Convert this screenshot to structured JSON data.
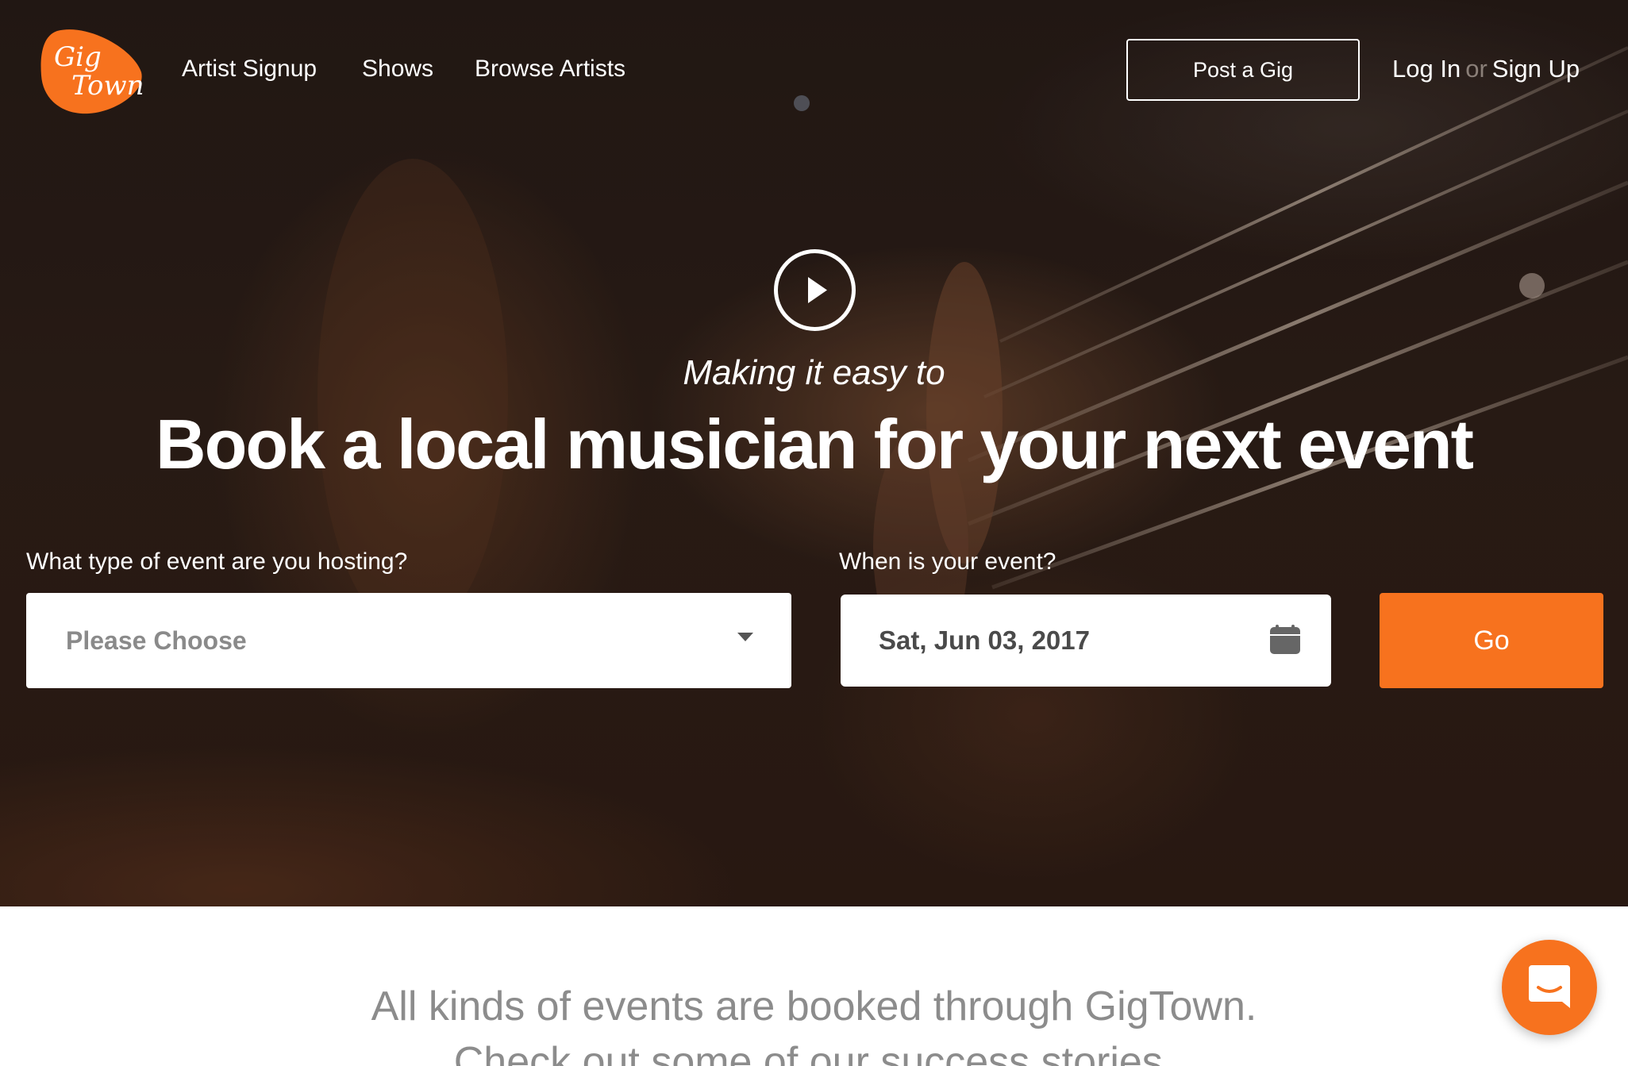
{
  "brand": {
    "logo_text_line1": "Gig",
    "logo_text_line2": "Town",
    "accent_color": "#f7721e"
  },
  "nav": {
    "links": [
      {
        "label": "Artist Signup"
      },
      {
        "label": "Shows"
      },
      {
        "label": "Browse Artists"
      }
    ],
    "post_gig_label": "Post a Gig",
    "login_label": "Log In",
    "or_label": "or",
    "signup_label": "Sign Up"
  },
  "hero": {
    "play_icon": "play-circle-icon",
    "tagline": "Making it easy to",
    "headline": "Book a local musician for your next event"
  },
  "search": {
    "event_type_label": "What type of event are you hosting?",
    "event_type_value": "Please Choose",
    "date_label": "When is your event?",
    "date_value": "Sat, Jun 03, 2017",
    "calendar_icon": "calendar-icon",
    "go_label": "Go"
  },
  "below": {
    "line1": "All kinds of events are booked through GigTown.",
    "line2": "Check out some of our success stories."
  },
  "chat": {
    "icon": "chat-bubble-icon"
  }
}
